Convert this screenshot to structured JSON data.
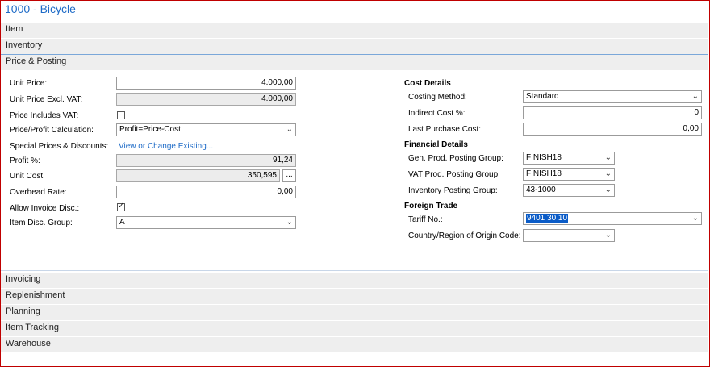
{
  "window": {
    "title": "1000 - Bicycle"
  },
  "sections": {
    "item": "Item",
    "inventory": "Inventory",
    "price_posting": "Price & Posting",
    "invoicing": "Invoicing",
    "replenishment": "Replenishment",
    "planning": "Planning",
    "item_tracking": "Item Tracking",
    "warehouse": "Warehouse"
  },
  "price_posting": {
    "unit_price": {
      "label": "Unit Price:",
      "value": "4.000,00"
    },
    "unit_price_excl_vat": {
      "label": "Unit Price Excl. VAT:",
      "value": "4.000,00"
    },
    "price_includes_vat": {
      "label": "Price Includes VAT:",
      "checked": false
    },
    "price_profit_calc": {
      "label": "Price/Profit Calculation:",
      "value": "Profit=Price-Cost"
    },
    "special_prices": {
      "label": "Special Prices & Discounts:",
      "link": "View or Change Existing..."
    },
    "profit_pct": {
      "label": "Profit %:",
      "value": "91,24"
    },
    "unit_cost": {
      "label": "Unit Cost:",
      "value": "350,595",
      "button": "..."
    },
    "overhead_rate": {
      "label": "Overhead Rate:",
      "value": "0,00"
    },
    "allow_invoice_disc": {
      "label": "Allow Invoice Disc.:",
      "checked": true
    },
    "item_disc_group": {
      "label": "Item Disc. Group:",
      "value": "A"
    }
  },
  "cost_details": {
    "heading": "Cost Details",
    "costing_method": {
      "label": "Costing Method:",
      "value": "Standard"
    },
    "indirect_cost": {
      "label": "Indirect Cost %:",
      "value": "0"
    },
    "last_purchase_cost": {
      "label": "Last Purchase Cost:",
      "value": "0,00"
    }
  },
  "financial_details": {
    "heading": "Financial Details",
    "gen_prod_posting_group": {
      "label": "Gen. Prod. Posting Group:",
      "value": "FINISH18"
    },
    "vat_prod_posting_group": {
      "label": "VAT Prod. Posting Group:",
      "value": "FINISH18"
    },
    "inventory_posting_group": {
      "label": "Inventory Posting Group:",
      "value": "43-1000"
    }
  },
  "foreign_trade": {
    "heading": "Foreign Trade",
    "tariff_no": {
      "label": "Tariff No.:",
      "value": "9401 30 10"
    },
    "country_region": {
      "label": "Country/Region of Origin Code:",
      "value": ""
    }
  },
  "icons": {
    "dropdown": "chevron-down-icon",
    "check": "checkmark-icon"
  },
  "colors": {
    "accent": "#1e6bc7",
    "frame": "#c00000",
    "selection": "#0b5cc7"
  }
}
